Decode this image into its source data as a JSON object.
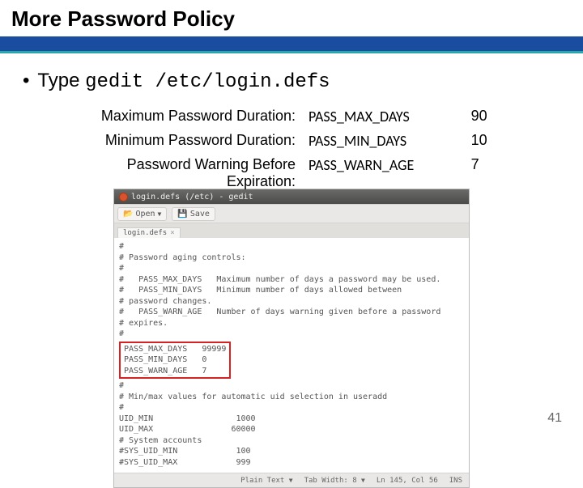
{
  "slide": {
    "title": "More Password Policy",
    "page_number": "41"
  },
  "bullet": {
    "prefix": "Type ",
    "command": "gedit /etc/login.defs"
  },
  "params": [
    {
      "label": "Maximum Password Duration:",
      "key": "PASS_MAX_DAYS",
      "value": "90"
    },
    {
      "label": "Minimum Password Duration:",
      "key": "PASS_MIN_DAYS",
      "value": "10"
    },
    {
      "label": "Password Warning Before Expiration:",
      "key": "PASS_WARN_AGE",
      "value": "7"
    }
  ],
  "editor": {
    "window_title": "login.defs (/etc) - gedit",
    "toolbar": {
      "open": "Open",
      "save": "Save"
    },
    "tab": "login.defs",
    "body_lines_top": [
      "#",
      "# Password aging controls:",
      "#",
      "#   PASS_MAX_DAYS   Maximum number of days a password may be used.",
      "#   PASS_MIN_DAYS   Minimum number of days allowed between",
      "# password changes.",
      "#   PASS_WARN_AGE   Number of days warning given before a password",
      "# expires.",
      "#"
    ],
    "body_lines_highlight": [
      "PASS_MAX_DAYS   99999",
      "PASS_MIN_DAYS   0",
      "PASS_WARN_AGE   7"
    ],
    "body_lines_bottom": [
      "",
      "#",
      "# Min/max values for automatic uid selection in useradd",
      "#",
      "UID_MIN                 1000",
      "UID_MAX                60000",
      "# System accounts",
      "#SYS_UID_MIN            100",
      "#SYS_UID_MAX            999"
    ],
    "status": {
      "syntax": "Plain Text",
      "tab_width": "Tab Width: 8",
      "position": "Ln 145, Col 56",
      "mode": "INS"
    }
  }
}
